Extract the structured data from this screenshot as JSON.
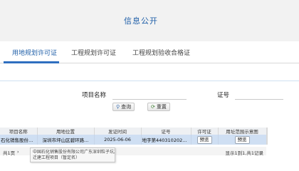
{
  "header": {
    "title": "信息公开"
  },
  "tabs": [
    {
      "label": "用地规划许可证",
      "active": true
    },
    {
      "label": "工程规划许可证",
      "active": false
    },
    {
      "label": "工程规划验收合格证",
      "active": false
    }
  ],
  "filters": {
    "project_name_label": "项目名称",
    "project_name_value": "",
    "cert_no_label": "证号",
    "cert_no_value": ""
  },
  "buttons": {
    "query": "查询",
    "reset": "重置"
  },
  "table": {
    "columns": [
      "项目名称",
      "用地位置",
      "发证时间",
      "证号",
      "许可证",
      "用址范围示意图"
    ],
    "rows": [
      {
        "project_name": "石化销售股份有...",
        "location": "深圳市坪山区碧环路...",
        "issue_date": "2025-06-06",
        "cert_no": "地字第4403102025Y...",
        "permit_btn": "预览",
        "map_btn": "预览"
      }
    ]
  },
  "pager": {
    "total_pages": "共1页",
    "next": "›",
    "info": "显示1到1,共1记录"
  },
  "tooltip": {
    "line1": "中国石化销售股份有限公司广东深圳粒子坑加油站",
    "line2": "迁建工程项目（暂定名）"
  },
  "colors": {
    "accent": "#1f5fa8",
    "selected_row": "#cfdff3",
    "header_bg": "#f2f2f2"
  }
}
